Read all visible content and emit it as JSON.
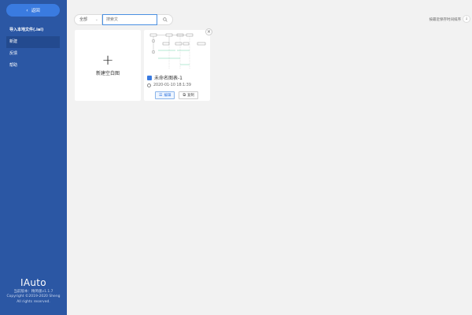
{
  "sidebar": {
    "back_label": "返回",
    "items": [
      {
        "label": "导入本地文件(.iai)"
      },
      {
        "label": "新建"
      },
      {
        "label": "反馈"
      },
      {
        "label": "帮助"
      }
    ],
    "brand": {
      "name": "IAuto",
      "version": "当前版本：精简版v1.1.7",
      "copyright": "Copyright ©2019-2020 Sheng",
      "rights": "All rights reserved."
    }
  },
  "toolbar": {
    "filter_value": "全部",
    "search_placeholder": "搜索文",
    "sort_label": "按最近保存时间排序"
  },
  "cards": {
    "new_label": "新建空白图",
    "files": [
      {
        "title": "未命名图表-1",
        "time": "2020-01-10 18:1:39",
        "edit_label": "编辑",
        "copy_label": "复制"
      }
    ]
  },
  "colors": {
    "sidebar_bg": "#2b57a4",
    "accent": "#3a7be0",
    "page_bg": "#f2f2f2"
  }
}
